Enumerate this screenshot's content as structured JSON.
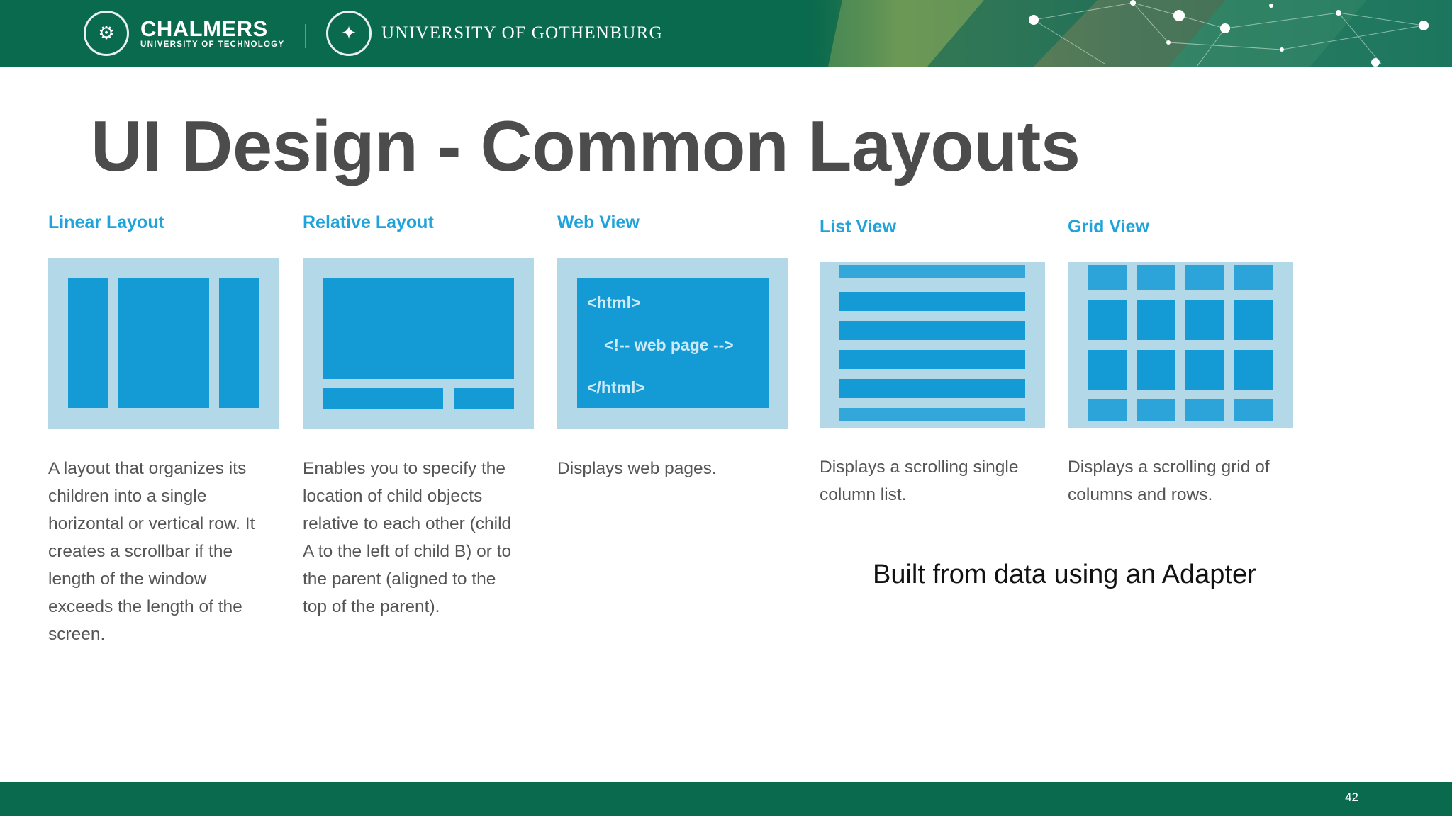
{
  "header": {
    "chalmers_name": "CHALMERS",
    "chalmers_sub": "UNIVERSITY OF TECHNOLOGY",
    "gu_name": "UNIVERSITY OF GOTHENBURG",
    "colors": {
      "brand_green": "#0a6a4d",
      "accent_blue": "#1fa3da"
    }
  },
  "slide": {
    "title": "UI Design - Common Layouts",
    "layouts": [
      {
        "title": "Linear Layout",
        "description": "A layout that organizes its\nchildren into a single\nhorizontal or vertical row. It\ncreates a scrollbar if the\nlength of the window\nexceeds the length of the\nscreen."
      },
      {
        "title": "Relative Layout",
        "description": "Enables you to specify the\nlocation of child objects\nrelative to each other (child\nA to the left of child B) or to\nthe parent (aligned to the\ntop of the parent)."
      },
      {
        "title": "Web View",
        "description": "Displays web pages.",
        "code_lines": [
          "<html>",
          "<!-- web page -->",
          "</html>"
        ]
      },
      {
        "title": "List View",
        "description": "Displays a scrolling single\ncolumn list."
      },
      {
        "title": "Grid View",
        "description": "Displays a scrolling grid of\ncolumns and rows."
      }
    ],
    "adapter_note": "Built from data using an Adapter"
  },
  "footer": {
    "page_number": "42"
  }
}
